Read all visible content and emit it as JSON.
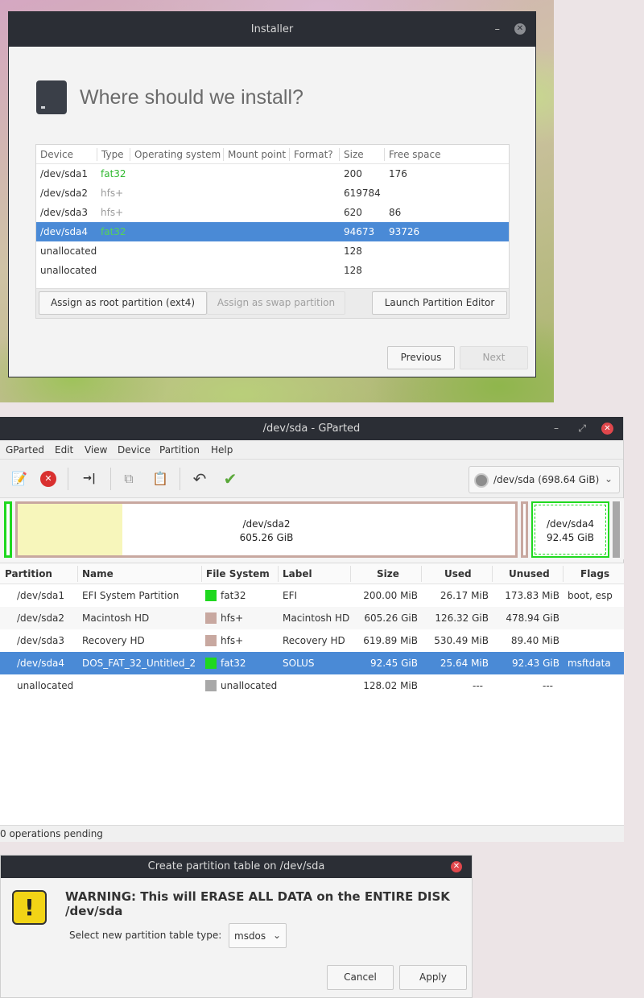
{
  "installer": {
    "title": "Installer",
    "minimize": "–",
    "close": "✕",
    "heading": "Where should we install?",
    "columns": [
      "Device",
      "Type",
      "Operating system",
      "Mount point",
      "Format?",
      "Size",
      "Free space"
    ],
    "rows": [
      {
        "device": "/dev/sda1",
        "type": "fat32",
        "os": "",
        "mount": "",
        "format": "",
        "size": "200",
        "free": "176"
      },
      {
        "device": "/dev/sda2",
        "type": "hfs+",
        "os": "",
        "mount": "",
        "format": "",
        "size": "619784",
        "free": ""
      },
      {
        "device": "/dev/sda3",
        "type": "hfs+",
        "os": "",
        "mount": "",
        "format": "",
        "size": "620",
        "free": "86"
      },
      {
        "device": "/dev/sda4",
        "type": "fat32",
        "os": "",
        "mount": "",
        "format": "",
        "size": "94673",
        "free": "93726"
      },
      {
        "device": "unallocated",
        "type": "",
        "os": "",
        "mount": "",
        "format": "",
        "size": "128",
        "free": ""
      },
      {
        "device": "unallocated",
        "type": "",
        "os": "",
        "mount": "",
        "format": "",
        "size": "128",
        "free": ""
      }
    ],
    "assign_root_label": "Assign as root partition (ext4)",
    "assign_swap_label": "Assign as swap partition",
    "launch_editor_label": "Launch Partition Editor",
    "previous_label": "Previous",
    "next_label": "Next"
  },
  "gparted": {
    "title": "/dev/sda - GParted",
    "window_controls": {
      "minimize": "–",
      "maximize": "⤢",
      "close": "✕"
    },
    "menu": [
      "GParted",
      "Edit",
      "View",
      "Device",
      "Partition",
      "Help"
    ],
    "device_selector": "/dev/sda  (698.64 GiB)",
    "device_chevron": "⌄",
    "toolbar_icons": [
      "new-icon",
      "delete-icon",
      "resize-move-icon",
      "copy-icon",
      "paste-icon",
      "undo-icon",
      "apply-icon"
    ],
    "toolbar_glyphs": {
      "new": "📝",
      "delete": "✕",
      "resize": "→|",
      "copy": "⧉",
      "paste": "📋",
      "undo": "↶",
      "apply": "✔"
    },
    "disk_map": {
      "sda2_label": "/dev/sda2",
      "sda2_size": "605.26 GiB",
      "sda4_label": "/dev/sda4",
      "sda4_size": "92.45 GiB"
    },
    "columns": [
      "Partition",
      "Name",
      "File System",
      "Label",
      "Size",
      "Used",
      "Unused",
      "Flags"
    ],
    "rows": [
      {
        "partition": "/dev/sda1",
        "name": "EFI System Partition",
        "fs": "fat32",
        "fs_color": "#1fd81f",
        "label": "EFI",
        "size": "200.00 MiB",
        "used": "26.17 MiB",
        "unused": "173.83 MiB",
        "flags": "boot, esp"
      },
      {
        "partition": "/dev/sda2",
        "name": "Macintosh HD",
        "fs": "hfs+",
        "fs_color": "#c8a8a0",
        "label": "Macintosh HD",
        "size": "605.26 GiB",
        "used": "126.32 GiB",
        "unused": "478.94 GiB",
        "flags": ""
      },
      {
        "partition": "/dev/sda3",
        "name": "Recovery HD",
        "fs": "hfs+",
        "fs_color": "#c8a8a0",
        "label": "Recovery HD",
        "size": "619.89 MiB",
        "used": "530.49 MiB",
        "unused": "89.40 MiB",
        "flags": ""
      },
      {
        "partition": "/dev/sda4",
        "name": "DOS_FAT_32_Untitled_2",
        "fs": "fat32",
        "fs_color": "#1fd81f",
        "label": "SOLUS",
        "size": "92.45 GiB",
        "used": "25.64 MiB",
        "unused": "92.43 GiB",
        "flags": "msftdata"
      },
      {
        "partition": "unallocated",
        "name": "",
        "fs": "unallocated",
        "fs_color": "#a8a8a8",
        "label": "",
        "size": "128.02 MiB",
        "used": "---",
        "unused": "---",
        "flags": ""
      }
    ],
    "status": "0 operations pending"
  },
  "dialog": {
    "title": "Create partition table on /dev/sda",
    "close": "✕",
    "warning_glyph": "!",
    "warning": "WARNING:  This will ERASE ALL DATA on the ENTIRE DISK /dev/sda",
    "select_label": "Select new partition table type:",
    "table_type": "msdos",
    "table_type_chevron": "⌄",
    "cancel_label": "Cancel",
    "apply_label": "Apply"
  },
  "colors": {
    "selection": "#4a8ad6",
    "fat32": "#1fd81f",
    "hfs": "#c8a8a0",
    "unallocated": "#a8a8a8",
    "titlebar": "#2b2e35",
    "close_red": "#e0474c"
  }
}
